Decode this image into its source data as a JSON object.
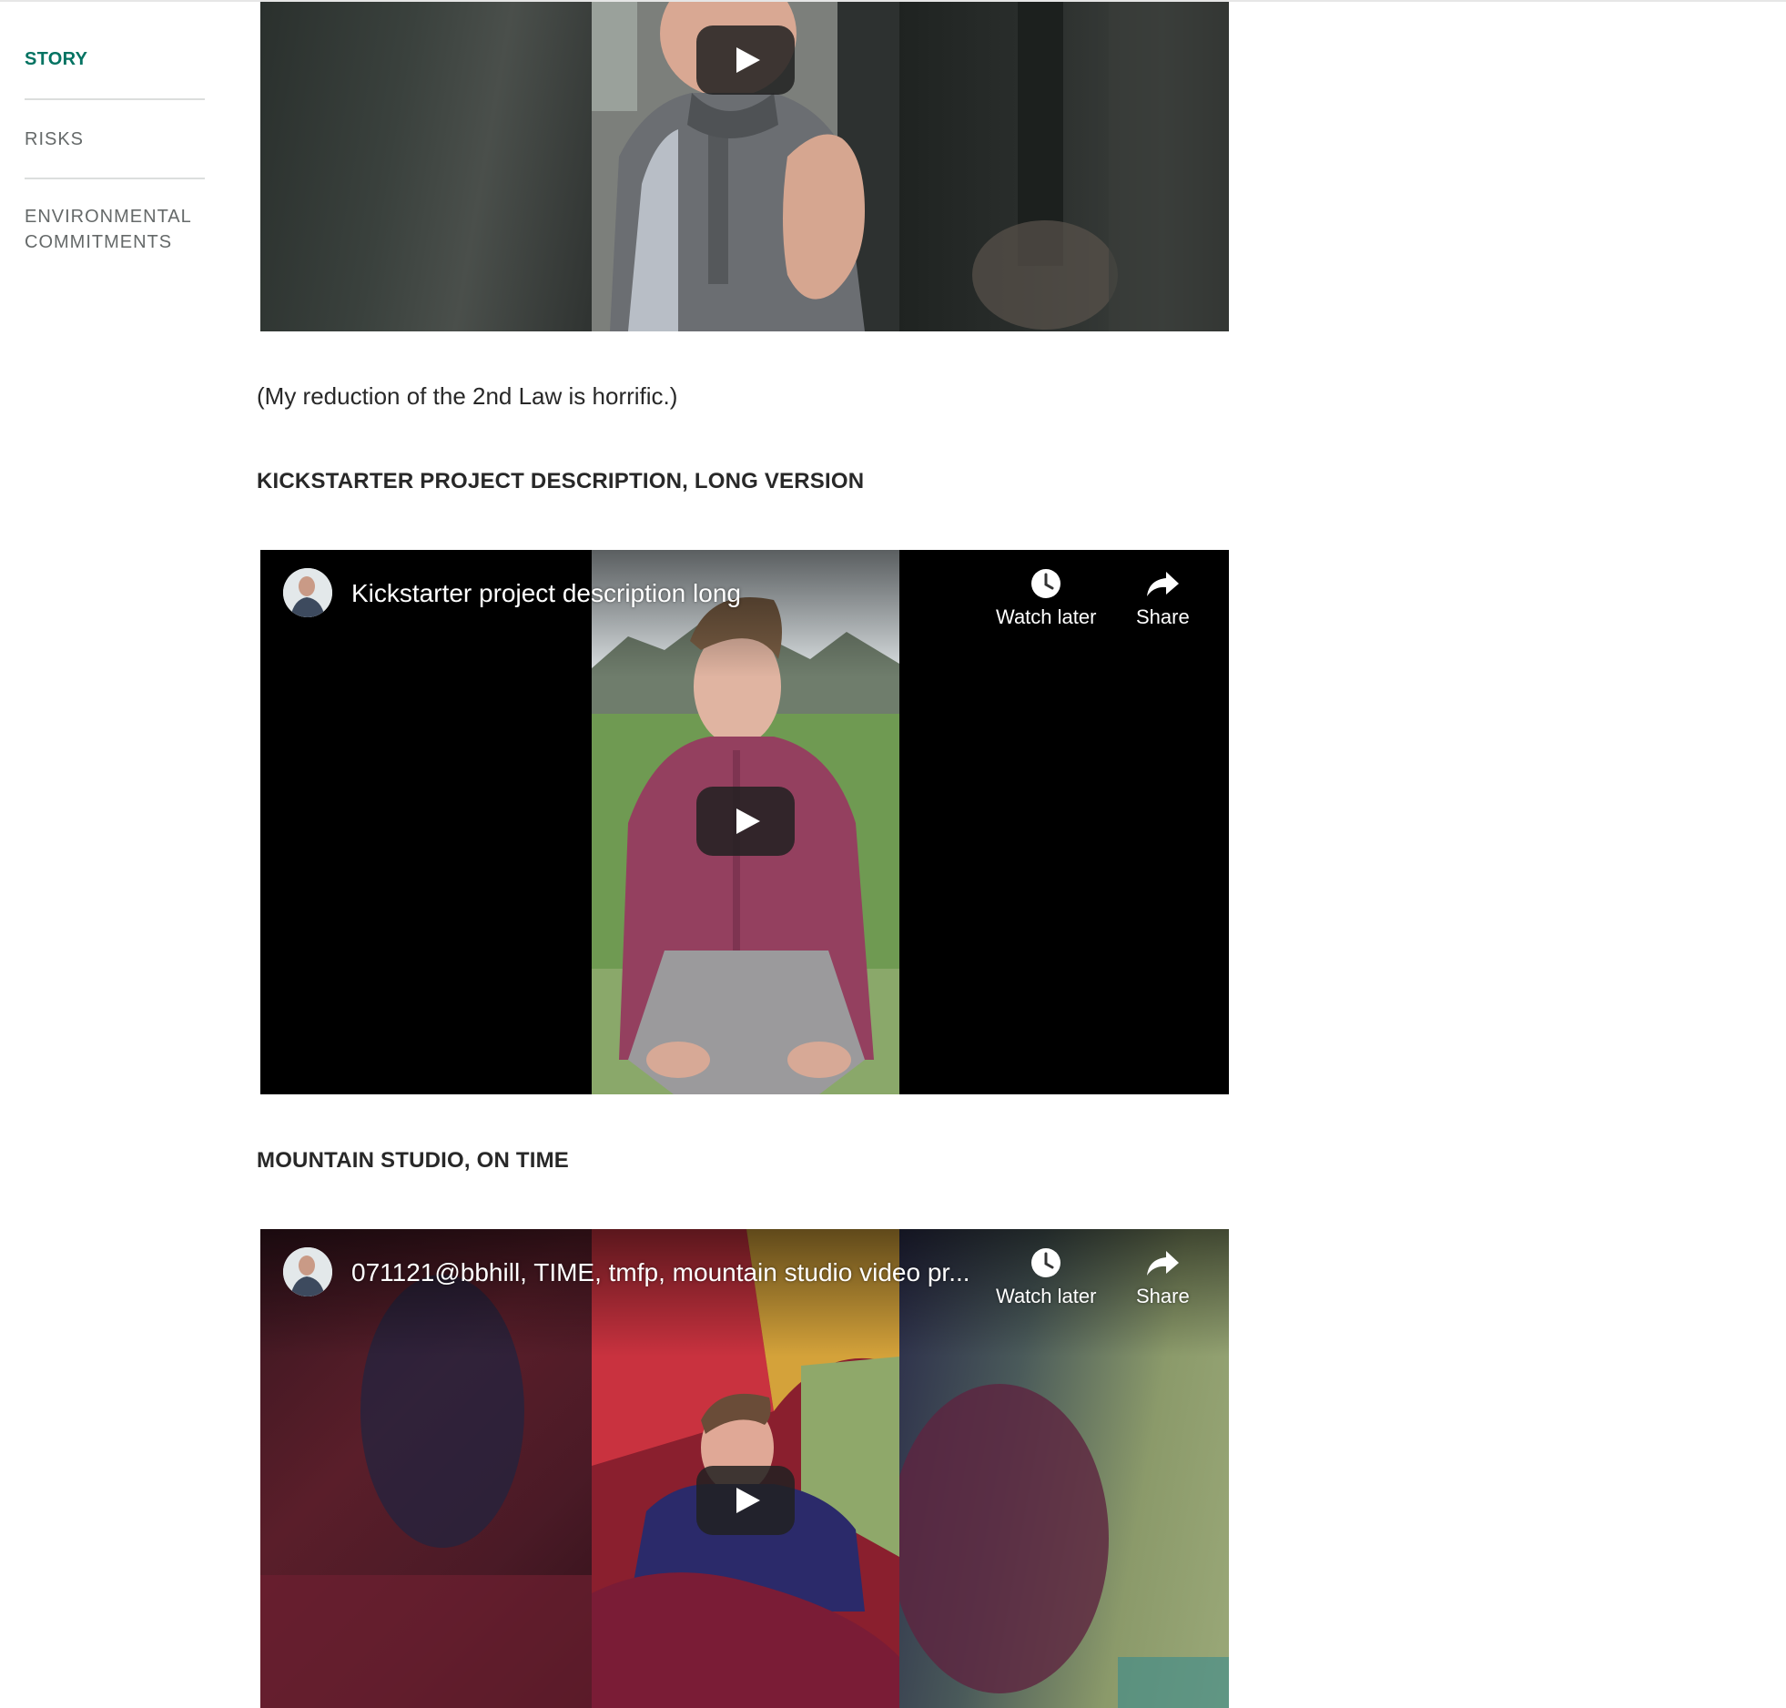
{
  "sidebar": {
    "items": [
      {
        "label": "STORY",
        "active": true
      },
      {
        "label": "RISKS",
        "active": false
      },
      {
        "label": "ENVIRONMENTAL COMMITMENTS",
        "active": false
      }
    ]
  },
  "main": {
    "caption": "(My reduction of the 2nd Law is horrific.)",
    "sections": [
      {
        "heading": "KICKSTARTER PROJECT DESCRIPTION, LONG VERSION"
      },
      {
        "heading": "MOUNTAIN STUDIO, ON TIME"
      }
    ],
    "videos": [
      {
        "title": "",
        "icon": "play-icon"
      },
      {
        "title": "Kickstarter project description long",
        "watch_later_label": "Watch later",
        "share_label": "Share"
      },
      {
        "title": "071121@bbhill, TIME, tmfp, mountain studio video pr...",
        "watch_later_label": "Watch later",
        "share_label": "Share"
      }
    ]
  },
  "colors": {
    "accent": "#037362",
    "text": "#282828",
    "muted": "#656969",
    "divider": "#dcdedd"
  }
}
